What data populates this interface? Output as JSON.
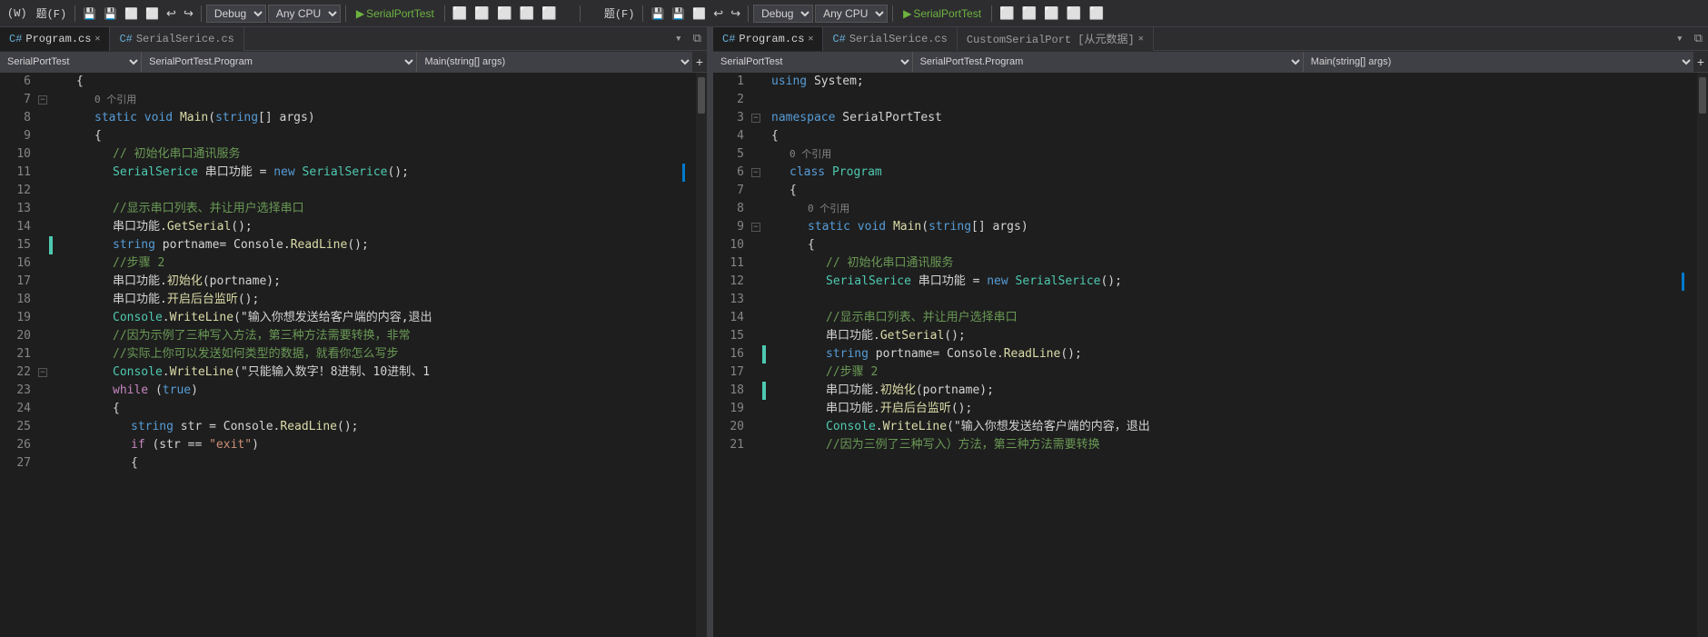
{
  "toolbar": {
    "left": {
      "menus": [
        "(W)",
        "题(F)"
      ],
      "buttons": [
        "⬛",
        "💾",
        "💾",
        "⬛",
        "⬛",
        "↩",
        "↪",
        "▸"
      ],
      "debug_dropdown": "Debug",
      "cpu_dropdown": "Any CPU",
      "play_label": "▶ SerialPortTest",
      "right_buttons": [
        "⬛",
        "⬛",
        "⬛",
        "⬛",
        "⬛"
      ]
    },
    "right": {
      "menus": [
        "题(F)"
      ],
      "buttons": [
        "⬛",
        "💾",
        "💾",
        "⬛",
        "⬛",
        "↩",
        "↪",
        "▸"
      ],
      "debug_dropdown": "Debug",
      "cpu_dropdown": "Any CPU",
      "play_label": "▶ SerialPortTest",
      "right_buttons": [
        "⬛",
        "⬛",
        "⬛",
        "⬛",
        "⬛"
      ]
    }
  },
  "left_editor": {
    "tabs": [
      {
        "label": "Program.cs",
        "active": true,
        "closable": true
      },
      {
        "label": "SerialSerice.cs",
        "active": false,
        "closable": false
      }
    ],
    "nav": {
      "namespace": "SerialPortTest",
      "class": "SerialPortTest.Program",
      "method": "Main(string[] args)"
    },
    "lines": [
      {
        "num": 6,
        "indent": 1,
        "tokens": [
          {
            "t": "plain",
            "v": "{"
          }
        ],
        "collapse": null,
        "gutter": ""
      },
      {
        "num": 7,
        "indent": 2,
        "tokens": [
          {
            "t": "ref-hint",
            "v": "0 个引用"
          }
        ],
        "collapse": null,
        "gutter": ""
      },
      {
        "num": 8,
        "indent": 2,
        "tokens": [
          {
            "t": "kw",
            "v": "static"
          },
          {
            "t": "plain",
            "v": " "
          },
          {
            "t": "kw",
            "v": "void"
          },
          {
            "t": "plain",
            "v": " "
          },
          {
            "t": "method",
            "v": "Main"
          },
          {
            "t": "plain",
            "v": "("
          },
          {
            "t": "kw",
            "v": "string"
          },
          {
            "t": "plain",
            "v": "[] args)"
          }
        ],
        "collapse": "minus",
        "gutter": ""
      },
      {
        "num": 9,
        "indent": 2,
        "tokens": [
          {
            "t": "plain",
            "v": "{"
          }
        ],
        "collapse": null,
        "gutter": ""
      },
      {
        "num": 10,
        "indent": 3,
        "tokens": [
          {
            "t": "comment",
            "v": "// 初始化串口通讯服务"
          }
        ],
        "collapse": null,
        "gutter": ""
      },
      {
        "num": 11,
        "indent": 3,
        "tokens": [
          {
            "t": "type",
            "v": "SerialSerice"
          },
          {
            "t": "plain",
            "v": " 串口功能 = "
          },
          {
            "t": "kw",
            "v": "new"
          },
          {
            "t": "plain",
            "v": " "
          },
          {
            "t": "type",
            "v": "SerialSerice"
          },
          {
            "t": "plain",
            "v": "();"
          }
        ],
        "collapse": null,
        "gutter": "",
        "active": true
      },
      {
        "num": 12,
        "indent": 3,
        "tokens": [],
        "collapse": null,
        "gutter": ""
      },
      {
        "num": 13,
        "indent": 3,
        "tokens": [
          {
            "t": "comment",
            "v": "//显示串口列表、并让用户选择串口"
          }
        ],
        "collapse": null,
        "gutter": ""
      },
      {
        "num": 14,
        "indent": 3,
        "tokens": [
          {
            "t": "plain",
            "v": "串口功能."
          },
          {
            "t": "method",
            "v": "GetSerial"
          },
          {
            "t": "plain",
            "v": "();"
          }
        ],
        "collapse": null,
        "gutter": ""
      },
      {
        "num": 15,
        "indent": 3,
        "tokens": [
          {
            "t": "kw",
            "v": "string"
          },
          {
            "t": "plain",
            "v": " portname= Console."
          },
          {
            "t": "method",
            "v": "ReadLine"
          },
          {
            "t": "plain",
            "v": "();"
          }
        ],
        "collapse": null,
        "gutter": "green"
      },
      {
        "num": 16,
        "indent": 3,
        "tokens": [
          {
            "t": "comment",
            "v": "//步骤 2"
          }
        ],
        "collapse": null,
        "gutter": ""
      },
      {
        "num": 17,
        "indent": 3,
        "tokens": [
          {
            "t": "plain",
            "v": "串口功能."
          },
          {
            "t": "method",
            "v": "初始化"
          },
          {
            "t": "plain",
            "v": "(portname);"
          }
        ],
        "collapse": null,
        "gutter": ""
      },
      {
        "num": 18,
        "indent": 3,
        "tokens": [
          {
            "t": "plain",
            "v": "串口功能."
          },
          {
            "t": "method",
            "v": "开启后台监听"
          },
          {
            "t": "plain",
            "v": "();"
          }
        ],
        "collapse": null,
        "gutter": ""
      },
      {
        "num": 19,
        "indent": 3,
        "tokens": [
          {
            "t": "type",
            "v": "Console"
          },
          {
            "t": "plain",
            "v": "."
          },
          {
            "t": "method",
            "v": "WriteLine"
          },
          {
            "t": "plain",
            "v": "(\"输入你想发送给客户端的内容,退出"
          }
        ],
        "collapse": null,
        "gutter": ""
      },
      {
        "num": 20,
        "indent": 3,
        "tokens": [
          {
            "t": "comment",
            "v": "//因为示例了三种写入方法，第三种方法需要转换，非常"
          }
        ],
        "collapse": null,
        "gutter": ""
      },
      {
        "num": 21,
        "indent": 3,
        "tokens": [
          {
            "t": "comment",
            "v": "//实际上你可以发送如何类型的数据，就看你怎么写步"
          }
        ],
        "collapse": null,
        "gutter": ""
      },
      {
        "num": 22,
        "indent": 3,
        "tokens": [
          {
            "t": "type",
            "v": "Console"
          },
          {
            "t": "plain",
            "v": "."
          },
          {
            "t": "method",
            "v": "WriteLine"
          },
          {
            "t": "plain",
            "v": "(\"只能输入数字！8进制、10进制、1"
          }
        ],
        "collapse": null,
        "gutter": ""
      },
      {
        "num": 23,
        "indent": 3,
        "tokens": [
          {
            "t": "kw2",
            "v": "while"
          },
          {
            "t": "plain",
            "v": " ("
          },
          {
            "t": "kw",
            "v": "true"
          },
          {
            "t": "plain",
            "v": ")"
          }
        ],
        "collapse": "minus",
        "gutter": ""
      },
      {
        "num": 24,
        "indent": 3,
        "tokens": [
          {
            "t": "plain",
            "v": "{"
          }
        ],
        "collapse": null,
        "gutter": ""
      },
      {
        "num": 25,
        "indent": 4,
        "tokens": [
          {
            "t": "kw",
            "v": "string"
          },
          {
            "t": "plain",
            "v": " str = Console."
          },
          {
            "t": "method",
            "v": "ReadLine"
          },
          {
            "t": "plain",
            "v": "();"
          }
        ],
        "collapse": null,
        "gutter": ""
      },
      {
        "num": 26,
        "indent": 4,
        "tokens": [
          {
            "t": "kw2",
            "v": "if"
          },
          {
            "t": "plain",
            "v": " (str == "
          },
          {
            "t": "string",
            "v": "\"exit\""
          },
          {
            "t": "plain",
            "v": ")"
          }
        ],
        "collapse": null,
        "gutter": ""
      },
      {
        "num": 27,
        "indent": 4,
        "tokens": [
          {
            "t": "plain",
            "v": "{"
          }
        ],
        "collapse": null,
        "gutter": ""
      }
    ]
  },
  "right_editor": {
    "tabs": [
      {
        "label": "Program.cs",
        "active": true,
        "closable": true
      },
      {
        "label": "SerialSerice.cs",
        "active": false,
        "closable": false
      },
      {
        "label": "CustomSerialPort [从元数据]",
        "active": false,
        "closable": true
      }
    ],
    "nav": {
      "namespace": "SerialPortTest",
      "class": "SerialPortTest.Program",
      "method": "Main(string[] args)"
    },
    "lines": [
      {
        "num": 1,
        "indent": 0,
        "tokens": [
          {
            "t": "kw",
            "v": "using"
          },
          {
            "t": "plain",
            "v": " System;"
          }
        ],
        "collapse": null,
        "gutter": ""
      },
      {
        "num": 2,
        "indent": 0,
        "tokens": [],
        "collapse": null,
        "gutter": ""
      },
      {
        "num": 3,
        "indent": 0,
        "tokens": [
          {
            "t": "kw",
            "v": "namespace"
          },
          {
            "t": "plain",
            "v": " SerialPortTest"
          }
        ],
        "collapse": "minus",
        "gutter": ""
      },
      {
        "num": 4,
        "indent": 0,
        "tokens": [
          {
            "t": "plain",
            "v": "{"
          }
        ],
        "collapse": null,
        "gutter": ""
      },
      {
        "num": 5,
        "indent": 1,
        "tokens": [
          {
            "t": "ref-hint",
            "v": "0 个引用"
          }
        ],
        "collapse": null,
        "gutter": ""
      },
      {
        "num": 6,
        "indent": 1,
        "tokens": [
          {
            "t": "kw",
            "v": "class"
          },
          {
            "t": "plain",
            "v": " "
          },
          {
            "t": "type",
            "v": "Program"
          }
        ],
        "collapse": "minus",
        "gutter": ""
      },
      {
        "num": 7,
        "indent": 1,
        "tokens": [
          {
            "t": "plain",
            "v": "{"
          }
        ],
        "collapse": null,
        "gutter": ""
      },
      {
        "num": 8,
        "indent": 2,
        "tokens": [
          {
            "t": "ref-hint",
            "v": "0 个引用"
          }
        ],
        "collapse": null,
        "gutter": ""
      },
      {
        "num": 9,
        "indent": 2,
        "tokens": [
          {
            "t": "kw",
            "v": "static"
          },
          {
            "t": "plain",
            "v": " "
          },
          {
            "t": "kw",
            "v": "void"
          },
          {
            "t": "plain",
            "v": " "
          },
          {
            "t": "method",
            "v": "Main"
          },
          {
            "t": "plain",
            "v": "("
          },
          {
            "t": "kw",
            "v": "string"
          },
          {
            "t": "plain",
            "v": "[] args)"
          }
        ],
        "collapse": "minus",
        "gutter": ""
      },
      {
        "num": 10,
        "indent": 2,
        "tokens": [
          {
            "t": "plain",
            "v": "{"
          }
        ],
        "collapse": null,
        "gutter": ""
      },
      {
        "num": 11,
        "indent": 3,
        "tokens": [
          {
            "t": "comment",
            "v": "// 初始化串口通讯服务"
          }
        ],
        "collapse": null,
        "gutter": ""
      },
      {
        "num": 12,
        "indent": 3,
        "tokens": [
          {
            "t": "type",
            "v": "SerialSerice"
          },
          {
            "t": "plain",
            "v": " 串口功能 = "
          },
          {
            "t": "kw",
            "v": "new"
          },
          {
            "t": "plain",
            "v": " "
          },
          {
            "t": "type",
            "v": "SerialSerice"
          },
          {
            "t": "plain",
            "v": "();"
          }
        ],
        "collapse": null,
        "gutter": "",
        "active": true
      },
      {
        "num": 13,
        "indent": 3,
        "tokens": [],
        "collapse": null,
        "gutter": ""
      },
      {
        "num": 14,
        "indent": 3,
        "tokens": [
          {
            "t": "comment",
            "v": "//显示串口列表、并让用户选择串口"
          }
        ],
        "collapse": null,
        "gutter": ""
      },
      {
        "num": 15,
        "indent": 3,
        "tokens": [
          {
            "t": "plain",
            "v": "串口功能."
          },
          {
            "t": "method",
            "v": "GetSerial"
          },
          {
            "t": "plain",
            "v": "();"
          }
        ],
        "collapse": null,
        "gutter": ""
      },
      {
        "num": 16,
        "indent": 3,
        "tokens": [
          {
            "t": "kw",
            "v": "string"
          },
          {
            "t": "plain",
            "v": " portname= Console."
          },
          {
            "t": "method",
            "v": "ReadLine"
          },
          {
            "t": "plain",
            "v": "();"
          }
        ],
        "collapse": null,
        "gutter": "green"
      },
      {
        "num": 17,
        "indent": 3,
        "tokens": [
          {
            "t": "comment",
            "v": "//步骤 2"
          }
        ],
        "collapse": null,
        "gutter": ""
      },
      {
        "num": 18,
        "indent": 3,
        "tokens": [
          {
            "t": "plain",
            "v": "串口功能."
          },
          {
            "t": "method",
            "v": "初始化"
          },
          {
            "t": "plain",
            "v": "(portname);"
          }
        ],
        "collapse": null,
        "gutter": "green"
      },
      {
        "num": 19,
        "indent": 3,
        "tokens": [
          {
            "t": "plain",
            "v": "串口功能."
          },
          {
            "t": "method",
            "v": "开启后台监听"
          },
          {
            "t": "plain",
            "v": "();"
          }
        ],
        "collapse": null,
        "gutter": ""
      },
      {
        "num": 20,
        "indent": 3,
        "tokens": [
          {
            "t": "type",
            "v": "Console"
          },
          {
            "t": "plain",
            "v": "."
          },
          {
            "t": "method",
            "v": "WriteLine"
          },
          {
            "t": "plain",
            "v": "(\"输入你想发送给客户端的内容，退出"
          }
        ],
        "collapse": null,
        "gutter": ""
      },
      {
        "num": 21,
        "indent": 3,
        "tokens": [
          {
            "t": "comment",
            "v": "//因为三例了三种写入）方法，第三种方法需要转换"
          }
        ],
        "collapse": null,
        "gutter": ""
      }
    ]
  }
}
